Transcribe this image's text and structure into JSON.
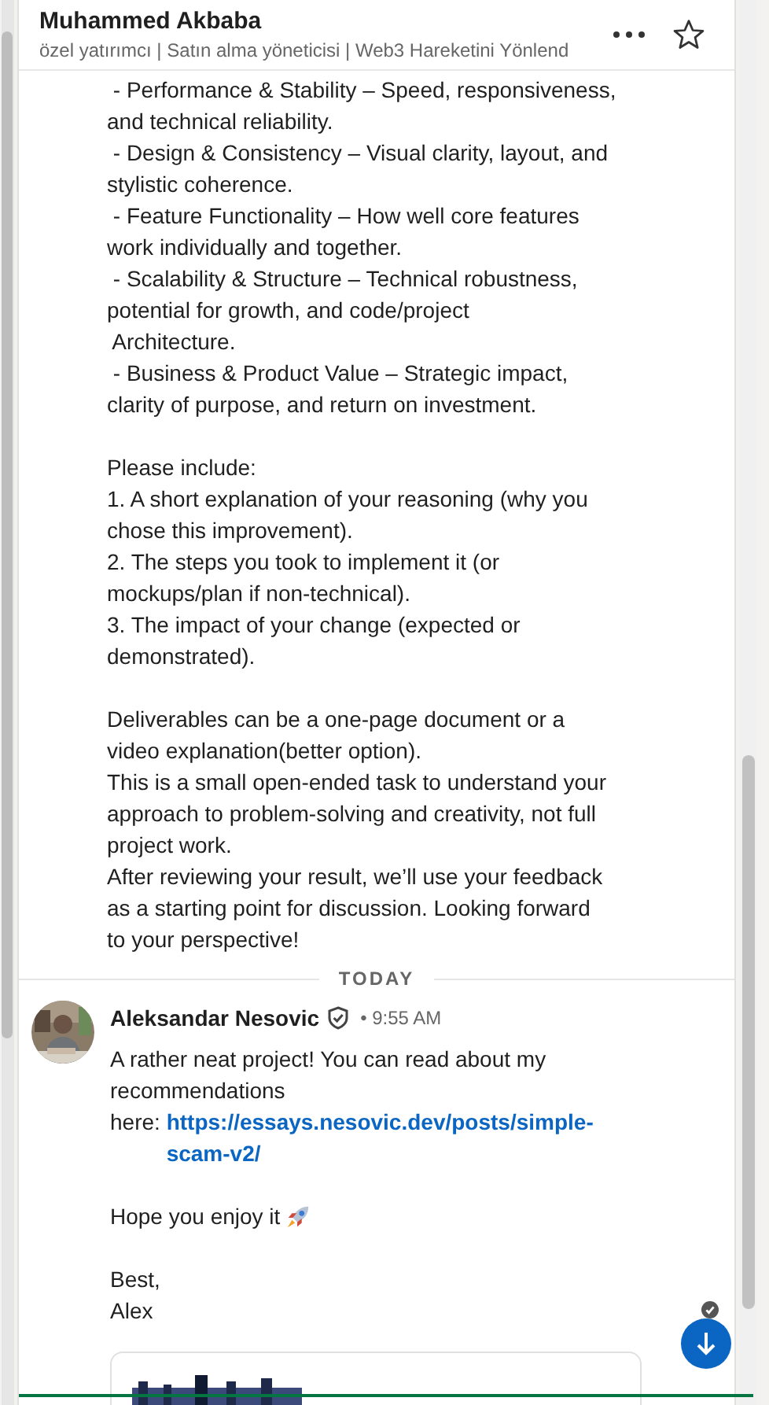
{
  "header": {
    "name": "Muhammed Akbaba",
    "subtitle": "özel yatırımcı | Satın alma yöneticisi | Web3 Hareketini Yönlend"
  },
  "earlier_message": {
    "paragraphs": [
      " - Performance & Stability – Speed, responsiveness,\nand technical reliability.\n - Design & Consistency – Visual clarity, layout, and\nstylistic coherence.\n - Feature Functionality – How well core features\nwork individually and together.\n - Scalability & Structure – Technical robustness,\npotential for growth, and code/project\n Architecture.\n - Business & Product Value – Strategic impact,\nclarity of purpose, and return on investment.",
      "Please include:\n1. A short explanation of your reasoning (why you\nchose this improvement).\n2. The steps you took to implement it (or\nmockups/plan if non-technical).\n3. The impact of your change (expected or\ndemonstrated).",
      "Deliverables can be a one-page document or a\nvideo explanation(better option).\nThis is a small open-ended task to understand your\napproach to problem-solving and creativity, not full\nproject work.\nAfter reviewing your result, we’ll use your feedback\nas a starting point for discussion. Looking forward\nto your perspective!"
    ]
  },
  "divider": "TODAY",
  "message": {
    "sender": "Aleksandar Nesovic",
    "verified": true,
    "time": "• 9:55 AM",
    "intro": "A rather neat project! You can read about my\nrecommendations\nhere: ",
    "link": "https://essays.nesovic.dev/posts/simple-\nscam-v2/",
    "closing": "Hope you enjoy it",
    "signoff": "Best,\nAlex"
  }
}
